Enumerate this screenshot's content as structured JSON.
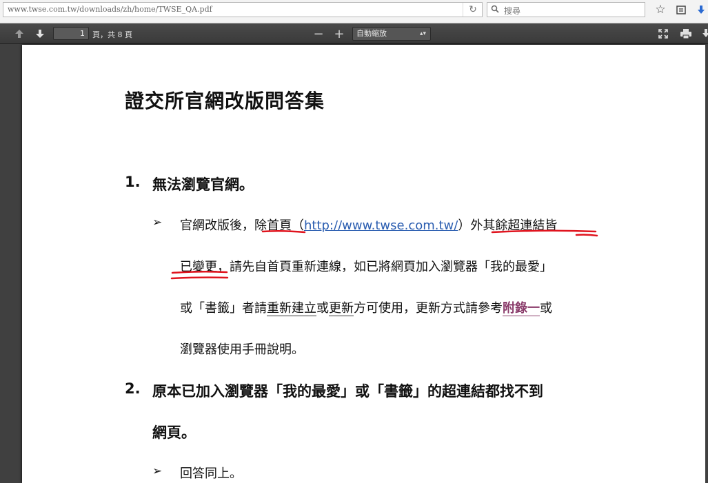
{
  "browser": {
    "url": "www.twse.com.tw/downloads/zh/home/TWSE_QA.pdf",
    "search_placeholder": "搜尋"
  },
  "pdf_toolbar": {
    "current_page": "1",
    "page_count_text": "頁，共 8 頁",
    "zoom_label": "自動縮放"
  },
  "document": {
    "title": "證交所官網改版問答集",
    "q1": {
      "number": "1.",
      "heading": "無法瀏覽官網。",
      "line1_a": "官網改版後，",
      "line1_b": "除首頁",
      "line1_c": "（",
      "line1_link": "http://www.twse.com.tw/",
      "line1_d": "）",
      "line1_e": "外其餘超連結皆",
      "line2_a": "已變更",
      "line2_b": "，請先自首頁重新連線，如已將網頁加入瀏覽器「我的最愛」",
      "line3_a": "或「書籤」者請",
      "line3_b": "重新建立",
      "line3_c": "或",
      "line3_d": "更新",
      "line3_e": "方可使用，更新方式請參考",
      "line3_f": "附錄一",
      "line3_g": "或",
      "line4": "瀏覽器使用手冊說明。"
    },
    "q2": {
      "number": "2.",
      "heading_line1": "原本已加入瀏覽器「我的最愛」或「書籤」的超連結都找不到",
      "heading_line2": "網頁。",
      "answer": "回答同上。"
    }
  },
  "colors": {
    "annotation_red": "#e0141e",
    "link_blue": "#2a5db0",
    "appendix_purple": "#8a3b6a"
  }
}
